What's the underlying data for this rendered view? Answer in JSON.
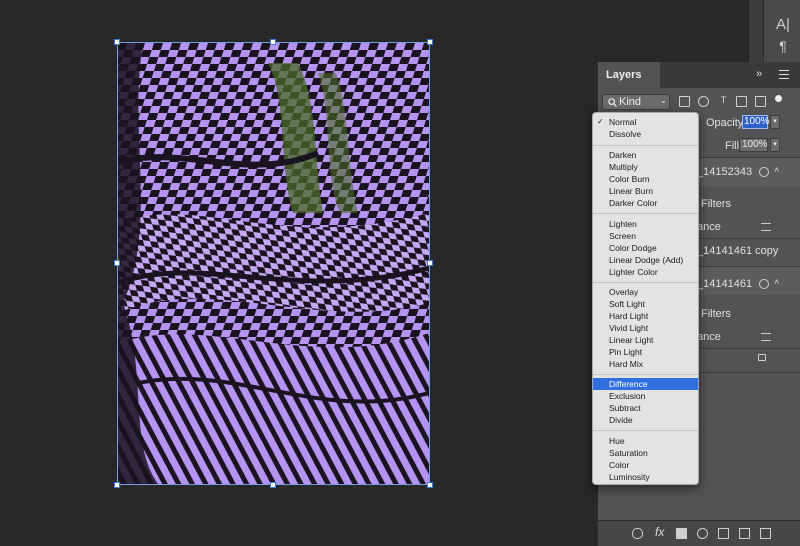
{
  "panel": {
    "tab_label": "Layers",
    "collapse_glyph": "»",
    "kind_label": "Kind",
    "opacity_label": "Opacity:",
    "opacity_value": "100%",
    "fill_label": "Fill:",
    "fill_value": "100%",
    "layers": [
      {
        "name_fragment": "_14152343",
        "filters_label": "Filters",
        "effect_fragment": "ance"
      },
      {
        "name_fragment": "_14141461 copy"
      },
      {
        "name_fragment": "_14141461",
        "filters_label": "Filters",
        "effect_fragment": "ance"
      }
    ]
  },
  "blend_menu": {
    "checked_item": "Normal",
    "highlighted_item": "Difference",
    "groups": [
      [
        "Normal",
        "Dissolve"
      ],
      [
        "Darken",
        "Multiply",
        "Color Burn",
        "Linear Burn",
        "Darker Color"
      ],
      [
        "Lighten",
        "Screen",
        "Color Dodge",
        "Linear Dodge (Add)",
        "Lighter Color"
      ],
      [
        "Overlay",
        "Soft Light",
        "Hard Light",
        "Vivid Light",
        "Linear Light",
        "Pin Light",
        "Hard Mix"
      ],
      [
        "Difference",
        "Exclusion",
        "Subtract",
        "Divide"
      ],
      [
        "Hue",
        "Saturation",
        "Color",
        "Luminosity"
      ]
    ]
  },
  "tool_strip": {
    "character_glyph": "A|",
    "paragraph_glyph": "¶"
  },
  "colors": {
    "art_purple": "#b493f1",
    "art_green": "#4b6b25",
    "art_dark": "#1a1320",
    "selection_blue": "#2f6fe0"
  }
}
